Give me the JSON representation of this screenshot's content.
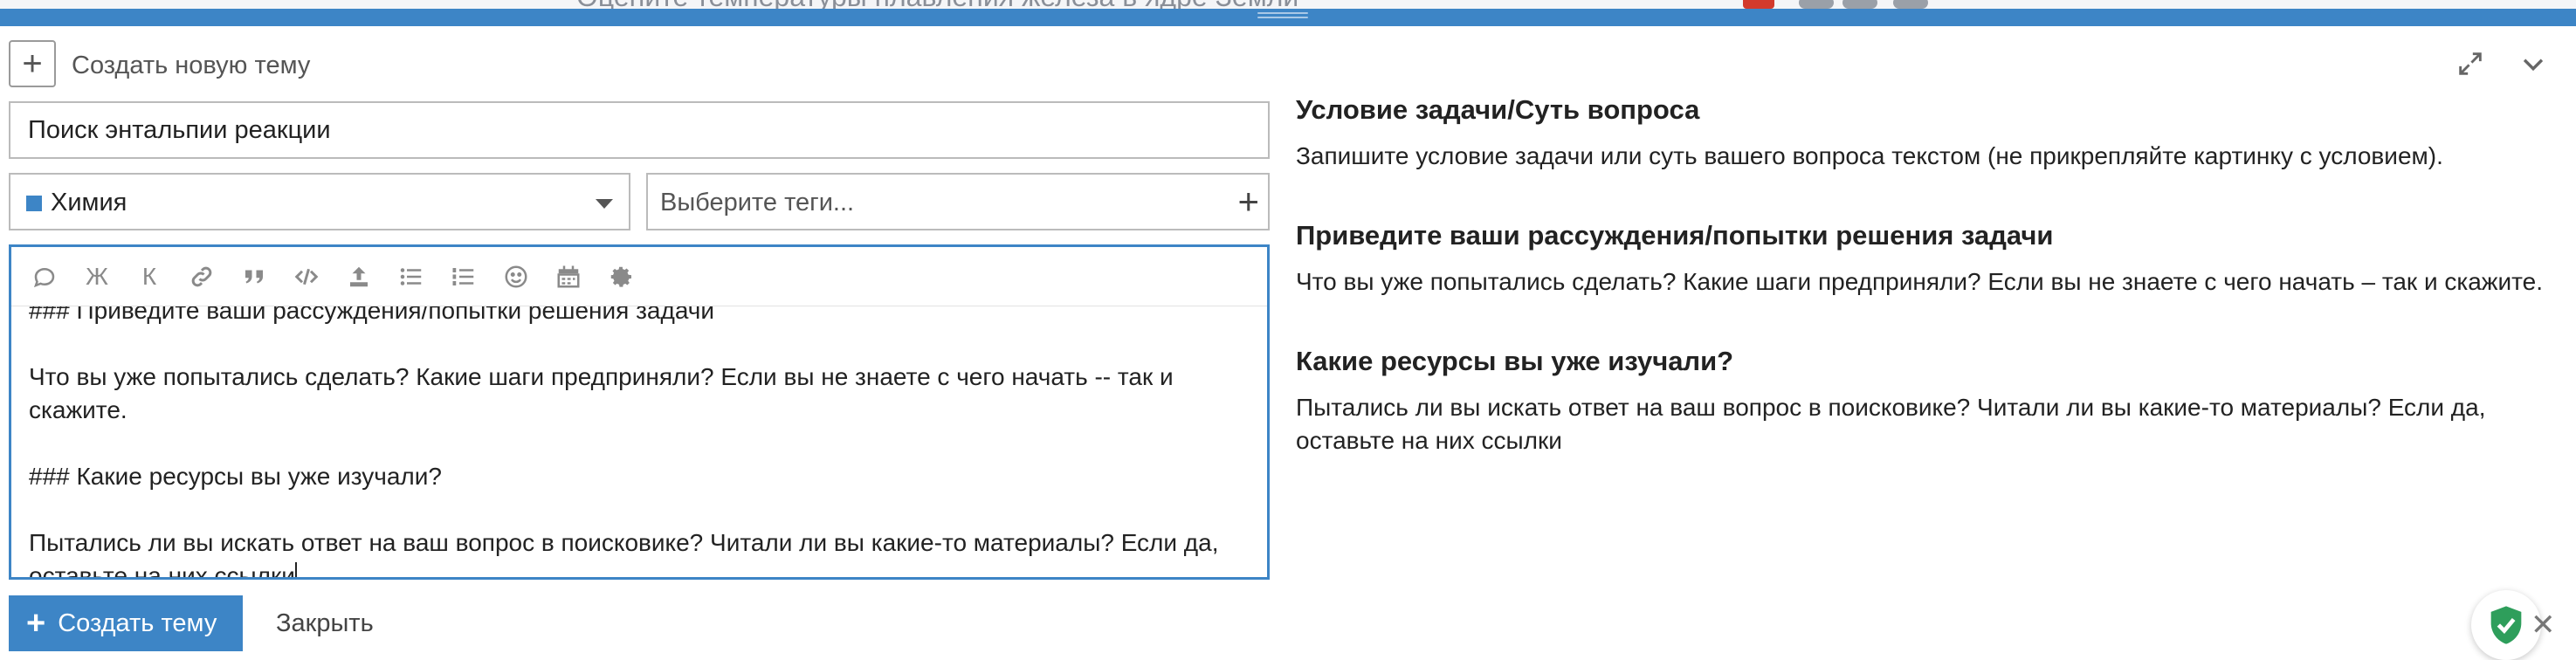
{
  "background_page": {
    "partial_text": "Оцените температуры плавления железа в ядре Земли"
  },
  "header": {
    "title": "Создать новую тему",
    "expand_icon": "expand-icon",
    "collapse_icon": "chevron-down-icon"
  },
  "form": {
    "title_value": "Поиск энтальпии реакции",
    "category": {
      "label": "Химия",
      "color": "#3d85c6"
    },
    "tags_placeholder": "Выберите теги...",
    "editor": {
      "toolbar": [
        "speech-bubble-icon",
        "bold-icon",
        "italic-icon",
        "link-icon",
        "quote-icon",
        "code-icon",
        "upload-icon",
        "bullet-list-icon",
        "numbered-list-icon",
        "emoji-icon",
        "calendar-icon",
        "gear-icon"
      ],
      "toolbar_labels": {
        "bold": "Ж",
        "italic": "К"
      },
      "cut_line": "### Приведите ваши рассуждения/попытки решения задачи",
      "line1": "Что вы уже попытались сделать? Какие шаги предприняли? Если вы не знаете с чего начать -- так и скажите.",
      "line2": "### Какие ресурсы вы уже изучали?",
      "line3": "Пытались ли вы искать ответ на ваш вопрос в поисковике? Читали ли вы какие-то материалы? Если да, оставьте на них ссылки"
    }
  },
  "preview": {
    "sections": [
      {
        "heading": "Условие задачи/Суть вопроса",
        "text": "Запишите условие задачи или суть вашего вопроса текстом (не прикрепляйте картинку с условием)."
      },
      {
        "heading": "Приведите ваши рассуждения/попытки решения задачи",
        "text": "Что вы уже попытались сделать? Какие шаги предприняли? Если вы не знаете с чего начать – так и скажите."
      },
      {
        "heading": "Какие ресурсы вы уже изучали?",
        "text": "Пытались ли вы искать ответ на ваш вопрос в поисковике? Читали ли вы какие-то материалы? Если да, оставьте на них ссылки"
      }
    ]
  },
  "footer": {
    "create_label": "Создать тему",
    "close_label": "Закрыть"
  },
  "colors": {
    "accent": "#3d85c6",
    "shield": "#2e9e5b"
  }
}
